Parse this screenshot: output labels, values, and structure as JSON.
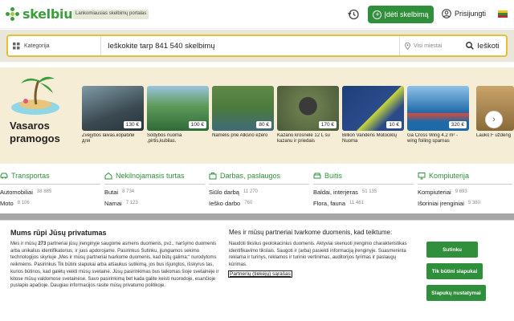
{
  "header": {
    "logo_text": "skelbiu",
    "tagline": "Lankomiausias skelbimų portalas",
    "add_label": "Įdėti skelbimą",
    "login_label": "Prisijungti",
    "flag_colors": [
      "#f2c21b",
      "#2e8b3b",
      "#c1272d"
    ]
  },
  "search": {
    "category_label": "Kategorija",
    "query_text": "Ieškokite tarp 841 540 skelbimų",
    "city_placeholder": "Visi miestai",
    "button_label": "Ieškoti"
  },
  "promo": {
    "title_line1": "Vasaros",
    "title_line2": "pramogos",
    "cards": [
      {
        "price": "130 €",
        "title": "Žvejybos laivas.корабли для",
        "color": "#3b4a52"
      },
      {
        "price": "100 €",
        "title": "Sodybos nuoma ,pirtis,kubilas.",
        "color": "#2f6a3a"
      },
      {
        "price": "80 €",
        "title": "Namelis prie Alksno ežero",
        "color": "#4c7a3e"
      },
      {
        "price": "170 €",
        "title": "Kazano krosnelė 12 L su kazanu ir priedais",
        "color": "#5a6b4a"
      },
      {
        "price": "10 €",
        "title": "Billion Vandens Motociklų Nuoma",
        "color": "#2a4a8a"
      },
      {
        "price": "320 €",
        "title": "Ga Cross Wing 4.2 m² - wing foiling sparnas",
        "color": "#1e6aa8"
      },
      {
        "price": "",
        "title": "Lauko F uždeng",
        "color": "#8a6a3a"
      }
    ]
  },
  "categories": [
    {
      "title": "Transportas",
      "items": [
        {
          "label": "Automobiliai",
          "count": "38 885"
        },
        {
          "label": "Moto",
          "count": "8 106"
        }
      ]
    },
    {
      "title": "Nekilnojamasis turtas",
      "items": [
        {
          "label": "Butai",
          "count": "8 734"
        },
        {
          "label": "Namai",
          "count": "7 123"
        }
      ]
    },
    {
      "title": "Darbas, paslaugos",
      "items": [
        {
          "label": "Siūlo darbą",
          "count": "11 270"
        },
        {
          "label": "Ieško darbo",
          "count": "760"
        }
      ]
    },
    {
      "title": "Buitis",
      "items": [
        {
          "label": "Baldai, interjeras",
          "count": "51 135"
        },
        {
          "label": "Flora, fauna",
          "count": "11 461"
        }
      ]
    },
    {
      "title": "Kompiuterija",
      "items": [
        {
          "label": "Kompiuteriai",
          "count": "9 693"
        },
        {
          "label": "Išoriniai įrenginiai",
          "count": "5 380"
        }
      ]
    }
  ],
  "consent": {
    "title": "Mums rūpi Jūsų privatumas",
    "body_before": "Mes ir mūsų ",
    "body_count": "273",
    "body_after": " partneriai jūsų įrenginyje saugome asmens duomenis, pvz., naršymo duomenis arba unikalius identifikatorius, ir juos apdorojame. Pasirinkus Sutinku, įjungiamos sekimo technologijos skyriuje „Mes ir mūsų partneriai tvarkome duomenis, kad būtų galima:“ nurodytoms reikmėms. Pasirinkus Tik būtini slapukai arba atšaukus sutikimą, jos bus išjungtos, išskyrus tas, kurios būtinos, kad galėtų veikti mūsų svetainė. Jūsų pasirinkimas bus taikomas šioje svetainėje ir kitose mūsų valdomose svetainėse. Savo pasirinkimą bet kada galite keisti nuorodoje, esančioje puslapio apačioje. Daugiau informacijos rasite mūsų privatumo politikoje.",
    "mid_title": "Mes ir mūsų partneriai tvarkome duomenis, kad teiktume:",
    "mid_body": "Naudoti tikslius geolokacinius duomenis. Aktyviai skenuoti įrenginio charakteristikas identifikavimo tikslais. Saugoti ir (arba) pasiekti informaciją įrenginyje. Suasmeninta reklama ir turinys, reklamos ir turinio vertinimas, auditorijos tyrimas ir paslaugų kūrimas.",
    "partners_link": "Partnerių (tiekėjų) sąrašas",
    "accept_label": "Sutinku",
    "necessary_label": "Tik būtini slapukai",
    "settings_label": "Slapukų nustatymai"
  }
}
